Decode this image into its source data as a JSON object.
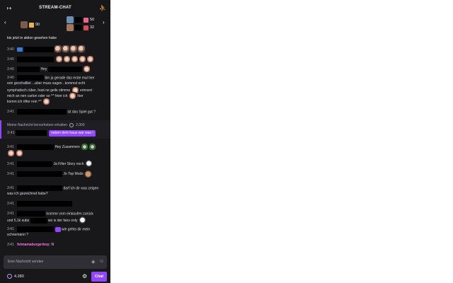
{
  "header": {
    "title": "STREAM-CHAT",
    "collapse_icon": "collapse-arrow-icon",
    "users_icon": "users-icon"
  },
  "leaderboard": {
    "items": [
      {
        "value": "90"
      },
      {
        "value": "50"
      },
      {
        "value": "32"
      }
    ]
  },
  "messages": [
    {
      "time": "",
      "text": "bis jetzt in aktion gesehen habe"
    },
    {
      "time": "3:40",
      "text": ""
    },
    {
      "time": "3:40",
      "text": ""
    },
    {
      "time": "3:40",
      "text": "Hey"
    },
    {
      "time": "3:40",
      "text": "bin ja gerade das erste mal hier"
    },
    {
      "time": "",
      "text": "rein geschalltet ...aber muss sagen ..kommst echt"
    },
    {
      "time": "",
      "text": "symphatisch rüber, hast ne geile stimme"
    },
    {
      "time": "",
      "text": "erinnert"
    },
    {
      "time": "",
      "text": "mich an nen carton oder so ^^ feier ich"
    },
    {
      "time": "",
      "text": "hier"
    },
    {
      "time": "",
      "text": "komm ich öfter rein ^^"
    },
    {
      "time": "3:41",
      "text": "ist das Spiel gut ?"
    },
    {
      "time": "3:41",
      "text": "Hey Zusammen"
    },
    {
      "time": "3:41",
      "text": "Ja Filter Story noch"
    },
    {
      "time": "3:41",
      "text": "Jo Top Mods"
    },
    {
      "time": "3:41",
      "text": "darf ich dir was zeigen"
    },
    {
      "time": "",
      "text": "was ich gezeichnet habe?"
    },
    {
      "time": "3:41",
      "text": ""
    },
    {
      "time": "3:41",
      "text": "komme vom einkaufen zurück"
    },
    {
      "time": "",
      "text": "und 5,1k subs"
    },
    {
      "time": "",
      "text": "wo is der fans only"
    },
    {
      "time": "3:41",
      "text": "wie gehts dir mein"
    },
    {
      "time": "",
      "text": "schnemann ?"
    },
    {
      "time": "3:41",
      "user": "fetmamaburgerboy:",
      "text": "N"
    }
  ],
  "highlight": {
    "label": "Meine Nachricht hervorheben erhalten",
    "cost": "2.000",
    "bubble": "neben dem haus war was !"
  },
  "input": {
    "placeholder": "Eine Nachricht senden"
  },
  "footer": {
    "points": "4.280",
    "chat_label": "Chat"
  },
  "colors": {
    "accent": "#9147ff",
    "background": "#18181b",
    "username": "#ff75e6"
  }
}
